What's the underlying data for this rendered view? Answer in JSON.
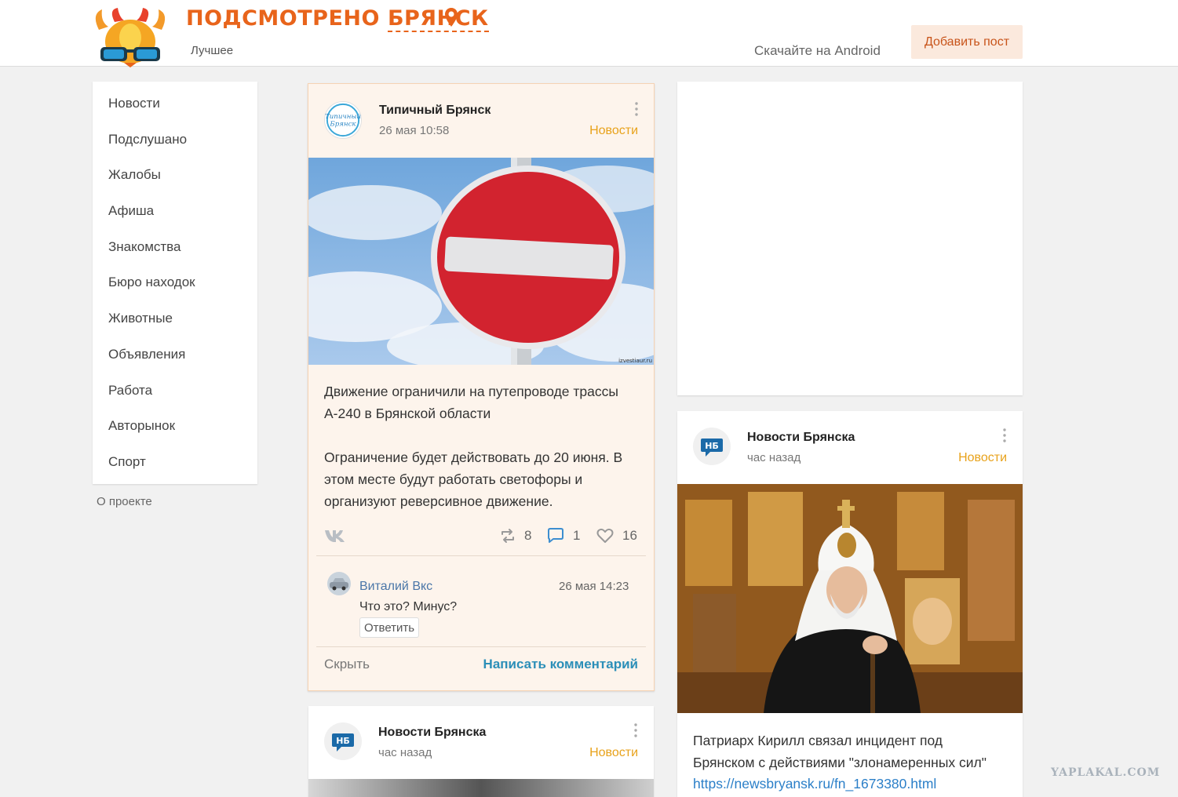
{
  "header": {
    "brand_main": "ПОДСМОТРЕНО",
    "brand_city": "БРЯНСК",
    "subtitle": "Лучшее",
    "android_link": "Скачайте на Android",
    "add_post_label": "Добавить пост"
  },
  "sidebar": {
    "items": [
      {
        "label": "Новости"
      },
      {
        "label": "Подслушано"
      },
      {
        "label": "Жалобы"
      },
      {
        "label": "Афиша"
      },
      {
        "label": "Знакомства"
      },
      {
        "label": "Бюро находок"
      },
      {
        "label": "Животные"
      },
      {
        "label": "Объявления"
      },
      {
        "label": "Работа"
      },
      {
        "label": "Авторынок"
      },
      {
        "label": "Спорт"
      }
    ],
    "about": "О проекте"
  },
  "posts": [
    {
      "author": "Типичный Брянск",
      "avatar_text_1": "Типичный",
      "avatar_text_2": "Брянск",
      "time": "26 мая 10:58",
      "category": "Новости",
      "image_credit": "izvestiaur.ru",
      "text_1": "Движение ограничили на путепроводе трассы А-240 в Брянской области",
      "text_2": "Ограничение будет действовать до 20 июня. В этом месте будут работать светофоры и организуют реверсивное движение.",
      "reposts": "8",
      "comments": "1",
      "likes": "16",
      "comment": {
        "author": "Виталий Вкс",
        "time": "26 мая 14:23",
        "text": "Что это? Минус?",
        "reply_label": "Ответить"
      },
      "hide_label": "Скрыть",
      "write_comment_label": "Написать комментарий"
    },
    {
      "author": "Новости Брянска",
      "avatar_text": "НБ",
      "time": "час назад",
      "category": "Новости",
      "text": "Патриарх Кирилл связал инцидент под Брянском с действиями \"злонамеренных сил\"",
      "link": "https://newsbryansk.ru/fn_1673380.html"
    },
    {
      "author": "Новости Брянска",
      "avatar_text": "НБ",
      "time": "час назад",
      "category": "Новости"
    }
  ],
  "watermark": "YAPLAKAL.COM",
  "colors": {
    "brand": "#e8641b",
    "category": "#e8a21b",
    "link": "#2b8fb8",
    "highlight_bg": "#fdf4ec"
  }
}
